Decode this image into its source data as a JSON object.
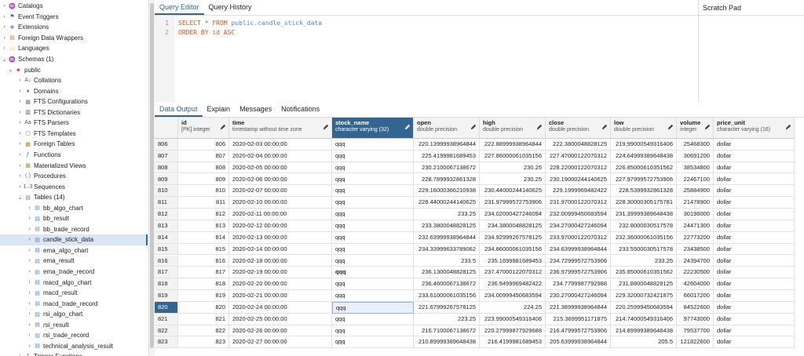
{
  "tree": [
    {
      "label": "Catalogs",
      "icon": "catalog-icon",
      "glyph": "♒",
      "color": "#8a5cc6",
      "indent": 0,
      "chev": "›",
      "selected": false
    },
    {
      "label": "Event Triggers",
      "icon": "event-trigger-icon",
      "glyph": "⚑",
      "color": "#3c6fb0",
      "indent": 0,
      "chev": "›",
      "selected": false
    },
    {
      "label": "Extensions",
      "icon": "extension-icon",
      "glyph": "❖",
      "color": "#5a8ab0",
      "indent": 0,
      "chev": "›",
      "selected": false
    },
    {
      "label": "Foreign Data Wrappers",
      "icon": "foreign-data-wrapper-icon",
      "glyph": "▤",
      "color": "#c47a2c",
      "indent": 0,
      "chev": "›",
      "selected": false
    },
    {
      "label": "Languages",
      "icon": "language-icon",
      "glyph": "▭",
      "color": "#e3b21c",
      "indent": 0,
      "chev": "›",
      "selected": false
    },
    {
      "label": "Schemas (1)",
      "icon": "schemas-icon",
      "glyph": "♒",
      "color": "#c0392b",
      "indent": 0,
      "chev": "⌄",
      "selected": false
    },
    {
      "label": "public",
      "icon": "schema-icon",
      "glyph": "◈",
      "color": "#c0392b",
      "indent": 1,
      "chev": "⌄",
      "selected": false
    },
    {
      "label": "Collations",
      "icon": "collation-icon",
      "glyph": "A↓",
      "color": "#c0392b",
      "indent": 2,
      "chev": "›",
      "selected": false
    },
    {
      "label": "Domains",
      "icon": "domain-icon",
      "glyph": "♦",
      "color": "#a0522d",
      "indent": 2,
      "chev": "›",
      "selected": false
    },
    {
      "label": "FTS Configurations",
      "icon": "fts-configuration-icon",
      "glyph": "▦",
      "color": "#777",
      "indent": 2,
      "chev": "›",
      "selected": false
    },
    {
      "label": "FTS Dictionaries",
      "icon": "fts-dictionary-icon",
      "glyph": "▥",
      "color": "#555",
      "indent": 2,
      "chev": "›",
      "selected": false
    },
    {
      "label": "FTS Parsers",
      "icon": "fts-parser-icon",
      "glyph": "Aa",
      "color": "#555",
      "indent": 2,
      "chev": "›",
      "selected": false
    },
    {
      "label": "FTS Templates",
      "icon": "fts-template-icon",
      "glyph": "▢",
      "color": "#777",
      "indent": 2,
      "chev": "›",
      "selected": false
    },
    {
      "label": "Foreign Tables",
      "icon": "foreign-table-icon",
      "glyph": "▦",
      "color": "#c47a2c",
      "indent": 2,
      "chev": "›",
      "selected": false
    },
    {
      "label": "Functions",
      "icon": "function-icon",
      "glyph": "ƒ",
      "color": "#3c6fb0",
      "indent": 2,
      "chev": "›",
      "selected": false
    },
    {
      "label": "Materialized Views",
      "icon": "materialized-view-icon",
      "glyph": "▦",
      "color": "#7cae3c",
      "indent": 2,
      "chev": "›",
      "selected": false
    },
    {
      "label": "Procedures",
      "icon": "procedure-icon",
      "glyph": "(·)",
      "color": "#3c6fb0",
      "indent": 2,
      "chev": "›",
      "selected": false
    },
    {
      "label": "Sequences",
      "icon": "sequence-icon",
      "glyph": "1..3",
      "color": "#555",
      "indent": 2,
      "chev": "›",
      "selected": false
    },
    {
      "label": "Tables (14)",
      "icon": "tables-icon",
      "glyph": "▤",
      "color": "#5a8ab0",
      "indent": 2,
      "chev": "⌄",
      "selected": false
    },
    {
      "label": "bb_algo_chart",
      "icon": "table-icon",
      "glyph": "▤",
      "color": "#5a8ab0",
      "indent": 3,
      "chev": "›",
      "selected": false
    },
    {
      "label": "bb_result",
      "icon": "table-icon",
      "glyph": "▤",
      "color": "#5a8ab0",
      "indent": 3,
      "chev": "›",
      "selected": false
    },
    {
      "label": "bb_trade_record",
      "icon": "table-icon",
      "glyph": "▤",
      "color": "#5a8ab0",
      "indent": 3,
      "chev": "›",
      "selected": false
    },
    {
      "label": "candle_stick_data",
      "icon": "table-icon",
      "glyph": "▤",
      "color": "#5a8ab0",
      "indent": 3,
      "chev": "›",
      "selected": true
    },
    {
      "label": "ema_algo_chart",
      "icon": "table-icon",
      "glyph": "▤",
      "color": "#5a8ab0",
      "indent": 3,
      "chev": "›",
      "selected": false
    },
    {
      "label": "ema_result",
      "icon": "table-icon",
      "glyph": "▤",
      "color": "#5a8ab0",
      "indent": 3,
      "chev": "›",
      "selected": false
    },
    {
      "label": "ema_trade_record",
      "icon": "table-icon",
      "glyph": "▤",
      "color": "#5a8ab0",
      "indent": 3,
      "chev": "›",
      "selected": false
    },
    {
      "label": "macd_algo_chart",
      "icon": "table-icon",
      "glyph": "▤",
      "color": "#5a8ab0",
      "indent": 3,
      "chev": "›",
      "selected": false
    },
    {
      "label": "macd_result",
      "icon": "table-icon",
      "glyph": "▤",
      "color": "#5a8ab0",
      "indent": 3,
      "chev": "›",
      "selected": false
    },
    {
      "label": "macd_trade_record",
      "icon": "table-icon",
      "glyph": "▤",
      "color": "#5a8ab0",
      "indent": 3,
      "chev": "›",
      "selected": false
    },
    {
      "label": "rsi_algo_chart",
      "icon": "table-icon",
      "glyph": "▤",
      "color": "#5a8ab0",
      "indent": 3,
      "chev": "›",
      "selected": false
    },
    {
      "label": "rsi_result",
      "icon": "table-icon",
      "glyph": "▤",
      "color": "#5a8ab0",
      "indent": 3,
      "chev": "›",
      "selected": false
    },
    {
      "label": "rsi_trade_record",
      "icon": "table-icon",
      "glyph": "▤",
      "color": "#5a8ab0",
      "indent": 3,
      "chev": "›",
      "selected": false
    },
    {
      "label": "technical_analysis_result",
      "icon": "table-icon",
      "glyph": "▤",
      "color": "#5a8ab0",
      "indent": 3,
      "chev": "›",
      "selected": false
    },
    {
      "label": "Trigger Functions",
      "icon": "trigger-function-icon",
      "glyph": "ƒ",
      "color": "#3c6fb0",
      "indent": 2,
      "chev": "›",
      "selected": false
    }
  ],
  "query_tabs": [
    "Query Editor",
    "Query History"
  ],
  "scratch_pad": "Scratch Pad",
  "editor": {
    "lines": [
      {
        "num": "1",
        "parts": [
          {
            "t": "SELECT",
            "c": "kw"
          },
          {
            "t": " * ",
            "c": "kw"
          },
          {
            "t": "FROM",
            "c": "kw"
          },
          {
            "t": " public.",
            "c": "tbl"
          },
          {
            "t": "candle_stick_data",
            "c": "tbl"
          }
        ]
      },
      {
        "num": "2",
        "parts": [
          {
            "t": "ORDER BY",
            "c": "kw"
          },
          {
            "t": " id",
            "c": "id"
          },
          {
            "t": " ASC",
            "c": "kw"
          }
        ]
      }
    ]
  },
  "output_tabs": [
    "Data Output",
    "Explain",
    "Messages",
    "Notifications"
  ],
  "columns": [
    {
      "name": "",
      "type": "",
      "w": 30
    },
    {
      "name": "id",
      "type": "[PK] integer",
      "w": 65
    },
    {
      "name": "time",
      "type": "timestamp without time zone",
      "w": 131
    },
    {
      "name": "stock_name",
      "type": "character varying (32)",
      "w": 104
    },
    {
      "name": "open",
      "type": "double precision",
      "w": 84
    },
    {
      "name": "high",
      "type": "double precision",
      "w": 84
    },
    {
      "name": "close",
      "type": "double precision",
      "w": 83
    },
    {
      "name": "low",
      "type": "double precision",
      "w": 84
    },
    {
      "name": "volume",
      "type": "integer",
      "w": 47
    },
    {
      "name": "price_unit",
      "type": "character varying (16)",
      "w": 103
    }
  ],
  "rows": [
    [
      "806",
      "806",
      "2020-02-03 00:00:00",
      "qqq",
      "220.13999938964844",
      "222.88999938964844",
      "222.3800048828125",
      "219.99000549316406",
      "25468300",
      "dollar"
    ],
    [
      "807",
      "807",
      "2020-02-04 00:00:00",
      "qqq",
      "225.4199981689453",
      "227.86000061035156",
      "227.47000122070312",
      "224.64999389648438",
      "30691200",
      "dollar"
    ],
    [
      "808",
      "808",
      "2020-02-05 00:00:00",
      "qqq",
      "230.2100067138672",
      "230.25",
      "228.22000122070312",
      "226.85000610351562",
      "38534800",
      "dollar"
    ],
    [
      "809",
      "809",
      "2020-02-06 00:00:00",
      "qqq",
      "228.7899932861328",
      "230.25",
      "230.19000244140625",
      "227.97999572753906",
      "22467100",
      "dollar"
    ],
    [
      "810",
      "810",
      "2020-02-07 00:00:00",
      "qqq",
      "229.16000366210938",
      "230.44000244140625",
      "229.1999969482422",
      "228.5399932861328",
      "25884900",
      "dollar"
    ],
    [
      "811",
      "811",
      "2020-02-10 00:00:00",
      "qqq",
      "228.44000244140625",
      "231.97999572753906",
      "231.97000122070312",
      "228.30000305175781",
      "21478900",
      "dollar"
    ],
    [
      "812",
      "812",
      "2020-02-11 00:00:00",
      "qqq",
      "233.25",
      "234.02000427246094",
      "232.00999450683594",
      "231.39999389648438",
      "30198000",
      "dollar"
    ],
    [
      "813",
      "813",
      "2020-02-12 00:00:00",
      "qqq",
      "233.3800048828125",
      "234.3800048828125",
      "234.27000427246094",
      "232.8000030517578",
      "24471300",
      "dollar"
    ],
    [
      "814",
      "814",
      "2020-02-13 00:00:00",
      "qqq",
      "232.63999938964844",
      "234.92999267578125",
      "233.97000122070312",
      "232.36000061035156",
      "22773200",
      "dollar"
    ],
    [
      "815",
      "815",
      "2020-02-14 00:00:00",
      "qqq",
      "234.33999633789062",
      "234.86000061035156",
      "234.63999938964844",
      "233.5500030517578",
      "23438500",
      "dollar"
    ],
    [
      "816",
      "816",
      "2020-02-18 00:00:00",
      "qqq",
      "233.5",
      "235.1699981689453",
      "234.72999572753906",
      "233.25",
      "24394700",
      "dollar"
    ],
    [
      "817",
      "817",
      "2020-02-19 00:00:00",
      "qqq",
      "236.1300048828125",
      "237.47000122070312",
      "236.97999572753906",
      "235.85000610351562",
      "22230500",
      "dollar"
    ],
    [
      "818",
      "818",
      "2020-02-20 00:00:00",
      "qqq",
      "236.4600067138672",
      "236.9499969482422",
      "234.7799987792988",
      "231.8800048828125",
      "42604000",
      "dollar"
    ],
    [
      "819",
      "819",
      "2020-02-21 00:00:00",
      "qqq",
      "233.61000061035156",
      "234.00999450683594",
      "230.27000427246094",
      "229.32000732421875",
      "66017200",
      "dollar"
    ],
    [
      "820",
      "820",
      "2020-02-24 00:00:00",
      "qqq",
      "221.67999267578125",
      "224.25",
      "221.38999938964844",
      "220.25999450683594",
      "84522600",
      "dollar"
    ],
    [
      "821",
      "821",
      "2020-02-25 00:00:00",
      "qqq",
      "223.25",
      "223.99000549316406",
      "215.3699951171875",
      "214.74000549316406",
      "97743000",
      "dollar"
    ],
    [
      "822",
      "822",
      "2020-02-26 00:00:00",
      "qqq",
      "216.7100067138672",
      "220.27999877929688",
      "216.47999572753906",
      "214.89999389648438",
      "79537700",
      "dollar"
    ],
    [
      "823",
      "823",
      "2020-02-27 00:00:00",
      "qqq",
      "210.89999389648438",
      "216.4199981689453",
      "205.63999938964844",
      "205.5",
      "121822600",
      "dollar"
    ]
  ]
}
